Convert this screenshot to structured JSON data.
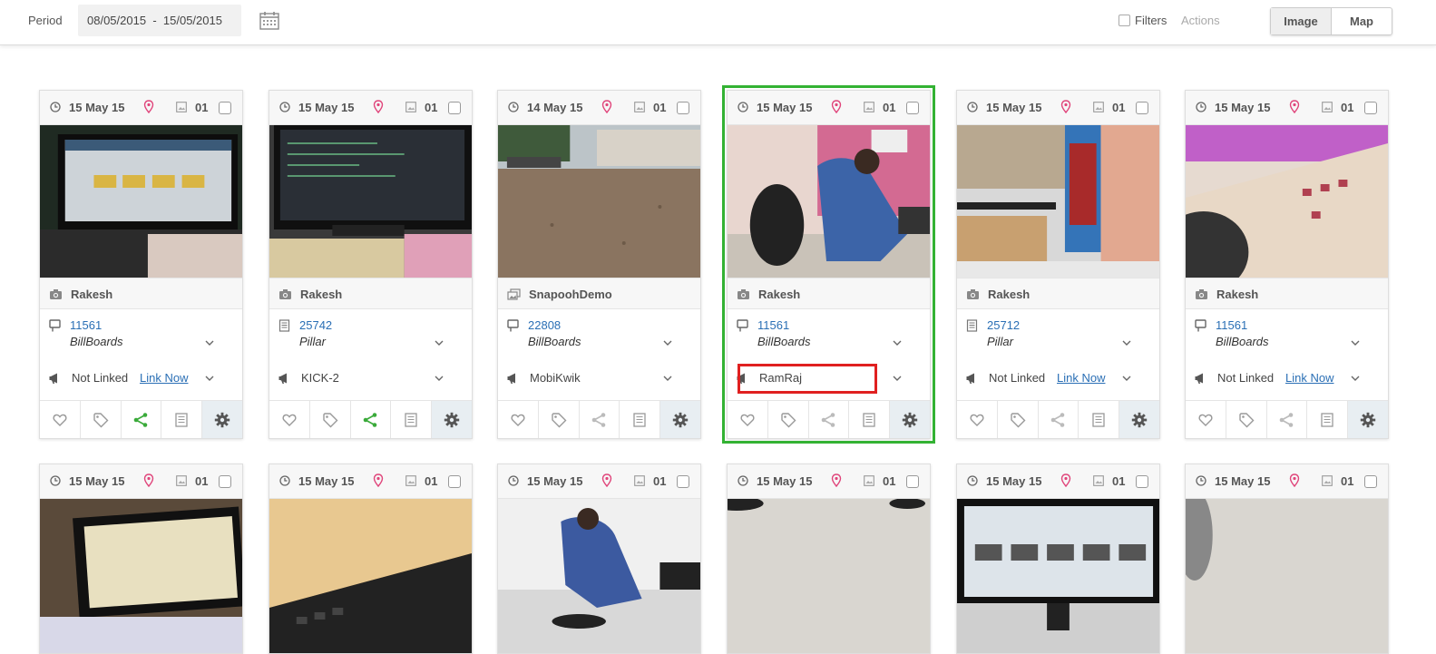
{
  "toolbar": {
    "period_label": "Period",
    "date_from": "08/05/2015",
    "date_sep": "-",
    "date_to": "15/05/2015",
    "filters_label": "Filters",
    "actions_label": "Actions",
    "view_image": "Image",
    "view_map": "Map"
  },
  "cards_row1": [
    {
      "date": "15 May 15",
      "count": "01",
      "owner": "Rakesh",
      "owner_icon": "camera-icon",
      "code": "11561",
      "type": "BillBoards",
      "type_icon": "billboard-icon",
      "brand": "Not Linked",
      "link": "Link Now",
      "share_active": true
    },
    {
      "date": "15 May 15",
      "count": "01",
      "owner": "Rakesh",
      "owner_icon": "camera-icon",
      "code": "25742",
      "type": "Pillar",
      "type_icon": "pillar-icon",
      "brand": "KICK-2",
      "link": "",
      "share_active": true
    },
    {
      "date": "14 May 15",
      "count": "01",
      "owner": "SnapoohDemo",
      "owner_icon": "gallery-icon",
      "code": "22808",
      "type": "BillBoards",
      "type_icon": "billboard-icon",
      "brand": "MobiKwik",
      "link": "",
      "share_active": false
    },
    {
      "date": "15 May 15",
      "count": "01",
      "owner": "Rakesh",
      "owner_icon": "camera-icon",
      "code": "11561",
      "type": "BillBoards",
      "type_icon": "billboard-icon",
      "brand": "RamRaj",
      "link": "",
      "share_active": false,
      "selected": true
    },
    {
      "date": "15 May 15",
      "count": "01",
      "owner": "Rakesh",
      "owner_icon": "camera-icon",
      "code": "25712",
      "type": "Pillar",
      "type_icon": "pillar-icon",
      "brand": "Not Linked",
      "link": "Link Now",
      "share_active": false
    },
    {
      "date": "15 May 15",
      "count": "01",
      "owner": "Rakesh",
      "owner_icon": "camera-icon",
      "code": "11561",
      "type": "BillBoards",
      "type_icon": "billboard-icon",
      "brand": "Not Linked",
      "link": "Link Now",
      "share_active": false
    }
  ],
  "cards_row2": [
    {
      "date": "15 May 15",
      "count": "01"
    },
    {
      "date": "15 May 15",
      "count": "01"
    },
    {
      "date": "15 May 15",
      "count": "01"
    },
    {
      "date": "15 May 15",
      "count": "01"
    },
    {
      "date": "15 May 15",
      "count": "01"
    },
    {
      "date": "15 May 15",
      "count": "01"
    }
  ],
  "colors": {
    "link": "#2a6fb5",
    "selected_outline": "#33b233",
    "highlight_box": "#e02020",
    "pin": "#e0457b",
    "share_active": "#3aaa3a"
  }
}
